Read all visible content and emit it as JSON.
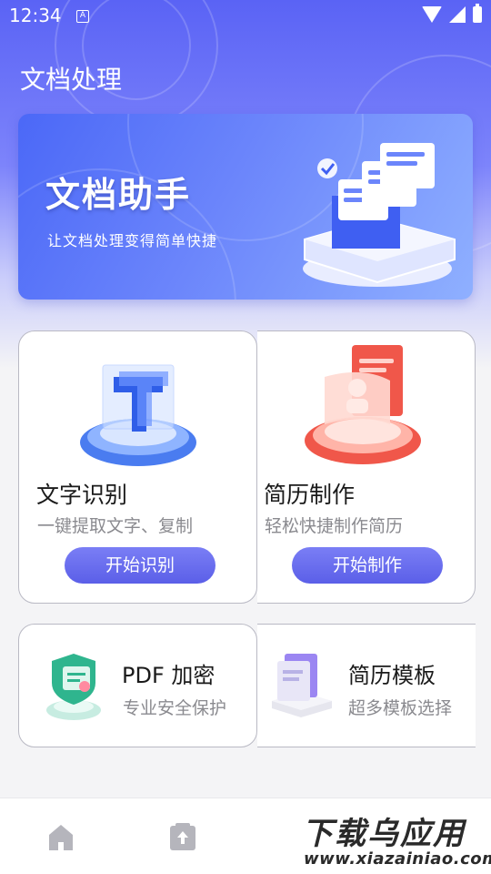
{
  "status_bar": {
    "time": "12:34",
    "notification_icon": "a-box-icon"
  },
  "header": {
    "title": "文档处理"
  },
  "banner": {
    "title": "文档助手",
    "subtitle": "让文档处理变得简单快捷"
  },
  "features": {
    "ocr": {
      "title": "文字识别",
      "subtitle": "一键提取文字、复制",
      "button": "开始识别"
    },
    "resume": {
      "title": "简历制作",
      "subtitle": "轻松快捷制作简历",
      "button": "开始制作"
    },
    "pdf": {
      "title": "PDF 加密",
      "subtitle": "专业安全保护"
    },
    "template": {
      "title": "简历模板",
      "subtitle": "超多模板选择"
    }
  },
  "bottom_nav": {
    "items": [
      "home-icon",
      "document-icon"
    ]
  },
  "watermark": {
    "main": "下载乌应用",
    "url": "www.xiazainiao.com"
  },
  "colors": {
    "accent": "#5b5fe8",
    "header": "#5a63f5",
    "resume_red": "#f0574a"
  }
}
